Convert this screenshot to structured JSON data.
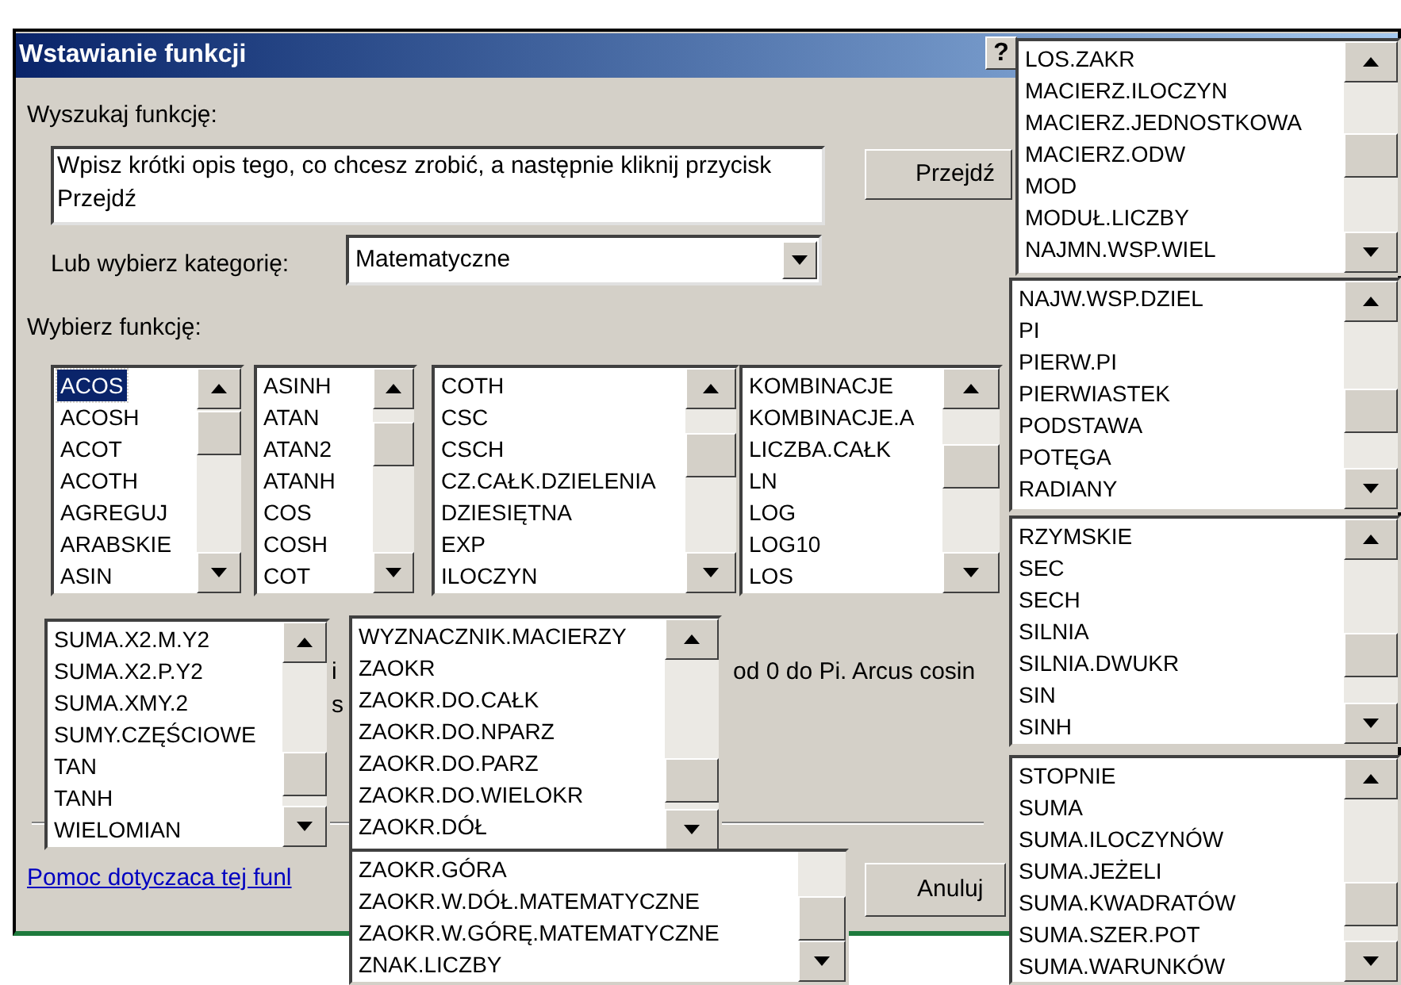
{
  "window": {
    "title": "Wstawianie funkcji",
    "help_button": "?"
  },
  "search": {
    "label": "Wyszukaj funkcję:",
    "value": "Wpisz krótki opis tego, co chcesz zrobić, a następnie kliknij przycisk Przejdź",
    "go_button": "Przejdź"
  },
  "category": {
    "label": "Lub wybierz kategorię:",
    "value": "Matematyczne"
  },
  "function_label": "Wybierz funkcję:",
  "description_fragments": [
    "i",
    "s",
    "od 0 do Pi. Arcus cosin"
  ],
  "help_link": "Pomoc dotyczaca tej funl",
  "cancel_button": "Anuluj",
  "lists": [
    {
      "items": [
        {
          "label": "ACOS",
          "selected": true
        },
        {
          "label": "ACOSH",
          "selected": false
        },
        {
          "label": "ACOT",
          "selected": false
        },
        {
          "label": "ACOTH",
          "selected": false
        },
        {
          "label": "AGREGUJ",
          "selected": false
        },
        {
          "label": "ARABSKIE",
          "selected": false
        },
        {
          "label": "ASIN",
          "selected": false
        }
      ]
    },
    {
      "items": [
        {
          "label": "ASINH",
          "selected": false
        },
        {
          "label": "ATAN",
          "selected": false
        },
        {
          "label": "ATAN2",
          "selected": false
        },
        {
          "label": "ATANH",
          "selected": false
        },
        {
          "label": "COS",
          "selected": false
        },
        {
          "label": "COSH",
          "selected": false
        },
        {
          "label": "COT",
          "selected": false
        }
      ]
    },
    {
      "items": [
        {
          "label": "COTH",
          "selected": false
        },
        {
          "label": "CSC",
          "selected": false
        },
        {
          "label": "CSCH",
          "selected": false
        },
        {
          "label": "CZ.CAŁK.DZIELENIA",
          "selected": false
        },
        {
          "label": "DZIESIĘTNA",
          "selected": false
        },
        {
          "label": "EXP",
          "selected": false
        },
        {
          "label": "ILOCZYN",
          "selected": false
        }
      ]
    },
    {
      "items": [
        {
          "label": "KOMBINACJE",
          "selected": false
        },
        {
          "label": "KOMBINACJE.A",
          "selected": false
        },
        {
          "label": "LICZBA.CAŁK",
          "selected": false
        },
        {
          "label": "LN",
          "selected": false
        },
        {
          "label": "LOG",
          "selected": false
        },
        {
          "label": "LOG10",
          "selected": false
        },
        {
          "label": "LOS",
          "selected": false
        }
      ]
    },
    {
      "items": [
        {
          "label": "SUMA.X2.M.Y2",
          "selected": false
        },
        {
          "label": "SUMA.X2.P.Y2",
          "selected": false
        },
        {
          "label": "SUMA.XMY.2",
          "selected": false
        },
        {
          "label": "SUMY.CZĘŚCIOWE",
          "selected": false
        },
        {
          "label": "TAN",
          "selected": false
        },
        {
          "label": "TANH",
          "selected": false
        },
        {
          "label": "WIELOMIAN",
          "selected": false
        }
      ]
    },
    {
      "items": [
        {
          "label": "WYZNACZNIK.MACIERZY",
          "selected": false
        },
        {
          "label": "ZAOKR",
          "selected": false
        },
        {
          "label": "ZAOKR.DO.CAŁK",
          "selected": false
        },
        {
          "label": "ZAOKR.DO.NPARZ",
          "selected": false
        },
        {
          "label": "ZAOKR.DO.PARZ",
          "selected": false
        },
        {
          "label": "ZAOKR.DO.WIELOKR",
          "selected": false
        },
        {
          "label": "ZAOKR.DÓŁ",
          "selected": false
        }
      ]
    },
    {
      "items": [
        {
          "label": "ZAOKR.GÓRA",
          "selected": false
        },
        {
          "label": "ZAOKR.W.DÓŁ.MATEMATYCZNE",
          "selected": false
        },
        {
          "label": "ZAOKR.W.GÓRĘ.MATEMATYCZNE",
          "selected": false
        },
        {
          "label": "ZNAK.LICZBY",
          "selected": false
        }
      ]
    },
    {
      "items": [
        {
          "label": "LOS.ZAKR",
          "selected": false
        },
        {
          "label": "MACIERZ.ILOCZYN",
          "selected": false
        },
        {
          "label": "MACIERZ.JEDNOSTKOWA",
          "selected": false
        },
        {
          "label": "MACIERZ.ODW",
          "selected": false
        },
        {
          "label": "MOD",
          "selected": false
        },
        {
          "label": "MODUŁ.LICZBY",
          "selected": false
        },
        {
          "label": "NAJMN.WSP.WIEL",
          "selected": false
        }
      ]
    },
    {
      "items": [
        {
          "label": "NAJW.WSP.DZIEL",
          "selected": false
        },
        {
          "label": "PI",
          "selected": false
        },
        {
          "label": "PIERW.PI",
          "selected": false
        },
        {
          "label": "PIERWIASTEK",
          "selected": false
        },
        {
          "label": "PODSTAWA",
          "selected": false
        },
        {
          "label": "POTĘGA",
          "selected": false
        },
        {
          "label": "RADIANY",
          "selected": false
        }
      ]
    },
    {
      "items": [
        {
          "label": "RZYMSKIE",
          "selected": false
        },
        {
          "label": "SEC",
          "selected": false
        },
        {
          "label": "SECH",
          "selected": false
        },
        {
          "label": "SILNIA",
          "selected": false
        },
        {
          "label": "SILNIA.DWUKR",
          "selected": false
        },
        {
          "label": "SIN",
          "selected": false
        },
        {
          "label": "SINH",
          "selected": false
        }
      ]
    },
    {
      "items": [
        {
          "label": "STOPNIE",
          "selected": false
        },
        {
          "label": "SUMA",
          "selected": false
        },
        {
          "label": "SUMA.ILOCZYNÓW",
          "selected": false
        },
        {
          "label": "SUMA.JEŻELI",
          "selected": false
        },
        {
          "label": "SUMA.KWADRATÓW",
          "selected": false
        },
        {
          "label": "SUMA.SZER.POT",
          "selected": false
        },
        {
          "label": "SUMA.WARUNKÓW",
          "selected": false
        }
      ]
    }
  ]
}
